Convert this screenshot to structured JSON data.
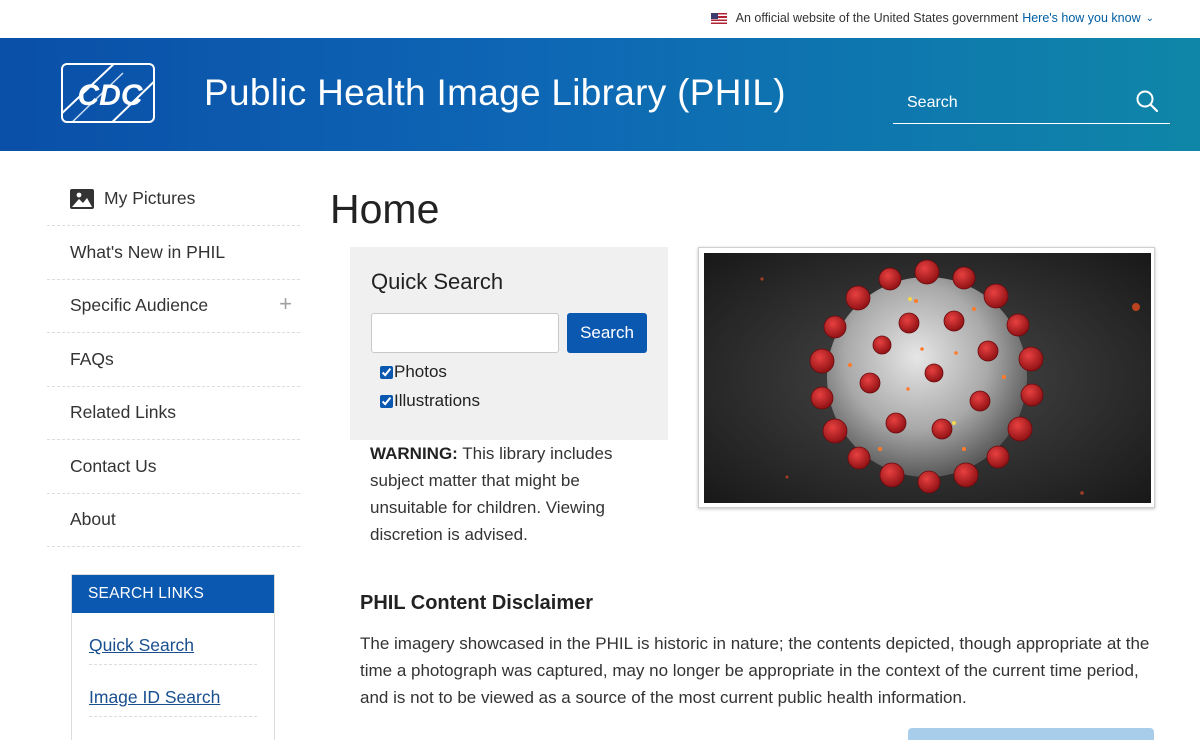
{
  "gov_banner": {
    "text": "An official website of the United States government",
    "link": "Here's how you know",
    "flag_icon": "us-flag-icon",
    "chevron_icon": "chevron-down-icon"
  },
  "header": {
    "logo_text": "CDC",
    "title": "Public Health Image Library (PHIL)",
    "search_placeholder": "Search",
    "search_icon": "search-icon",
    "colors": {
      "gradient_start": "#0a4fa8",
      "gradient_end": "#0f86a8"
    }
  },
  "sidebar": {
    "items": [
      {
        "label": "My Pictures",
        "icon": "picture-icon"
      },
      {
        "label": "What's New in PHIL"
      },
      {
        "label": "Specific Audience",
        "icon": "plus-icon"
      },
      {
        "label": "FAQs"
      },
      {
        "label": "Related Links"
      },
      {
        "label": "Contact Us"
      },
      {
        "label": "About"
      }
    ],
    "search_links": {
      "heading": "SEARCH LINKS",
      "items": [
        "Quick Search",
        "Image ID Search"
      ]
    }
  },
  "main": {
    "title": "Home",
    "quick_search": {
      "title": "Quick Search",
      "input_value": "",
      "button_label": "Search",
      "options": [
        {
          "label": "Photos",
          "checked": true
        },
        {
          "label": "Illustrations",
          "checked": true
        }
      ]
    },
    "warning": {
      "label": "WARNING:",
      "text": " This library includes subject matter that might be unsuitable for children. Viewing discretion is advised."
    },
    "disclaimer": {
      "title": "PHIL Content Disclaimer",
      "text": "The imagery showcased in the PHIL is historic in nature; the contents depicted, though appropriate at the time a photograph was captured, may no longer be appropriate in the context of the current time period, and is not to be viewed as a source of the most current public health information."
    }
  },
  "colors": {
    "primary_blue": "#0a58b0",
    "link_blue": "#1a4f8f",
    "panel_gray": "#f0f0f0"
  }
}
